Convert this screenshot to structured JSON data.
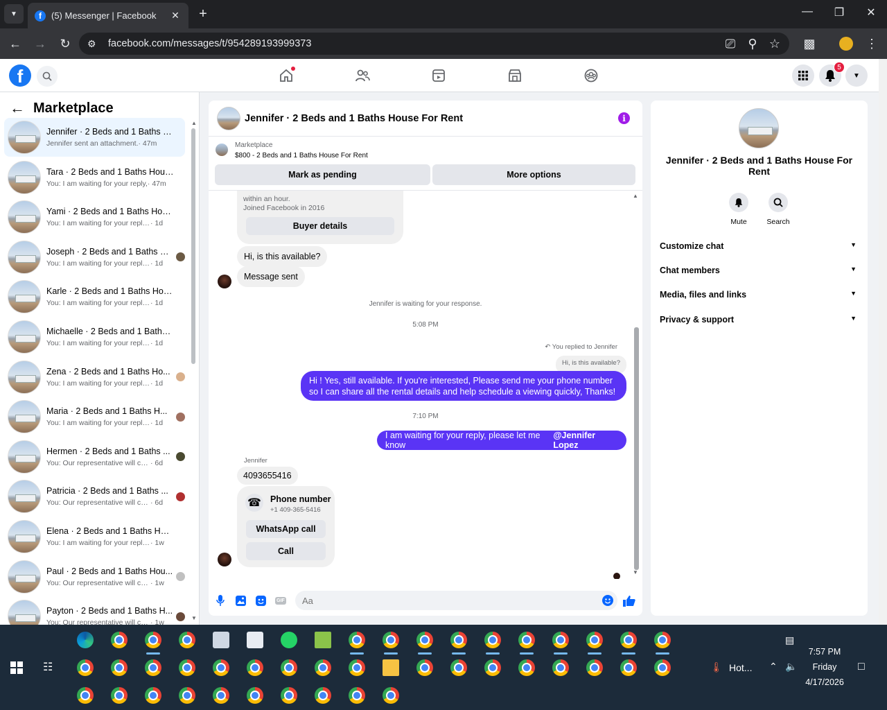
{
  "browser": {
    "tab_title": "(5) Messenger | Facebook",
    "url": "facebook.com/messages/t/954289193999373"
  },
  "fb": {
    "notification_count": "5"
  },
  "sidebar": {
    "title": "Marketplace",
    "conversations": [
      {
        "name": "Jennifer · 2 Beds and 1 Baths Ho...",
        "preview": "Jennifer sent an attachment.",
        "time": "· 47m"
      },
      {
        "name": "Tara · 2 Beds and 1 Baths House...",
        "preview": "You: I am waiting for your reply,",
        "time": "· 47m"
      },
      {
        "name": "Yami · 2 Beds and 1 Baths Hous...",
        "preview": "You: I am waiting for your reply, pl...",
        "time": "· 1d"
      },
      {
        "name": "Joseph · 2 Beds and 1 Baths H...",
        "preview": "You: I am waiting for your reply,...",
        "time": "· 1d"
      },
      {
        "name": "Karle · 2 Beds and 1 Baths Hous...",
        "preview": "You: I am waiting for your reply, pl...",
        "time": "· 1d"
      },
      {
        "name": "Michaelle · 2 Beds and 1 Baths ...",
        "preview": "You: I am waiting for your reply, pl...",
        "time": "· 1d"
      },
      {
        "name": "Zena · 2 Beds and 1 Baths Ho...",
        "preview": "You: I am waiting for your reply,...",
        "time": "· 1d"
      },
      {
        "name": "Maria · 2 Beds and 1 Baths H...",
        "preview": "You: I am waiting for your reply,...",
        "time": "· 1d"
      },
      {
        "name": "Hermen · 2 Beds and 1 Baths ...",
        "preview": "You: Our representative will con...",
        "time": "· 6d"
      },
      {
        "name": "Patricia · 2 Beds and 1 Baths ...",
        "preview": "You: Our representative will con...",
        "time": "· 6d"
      },
      {
        "name": "Elena · 2 Beds and 1 Baths Hous...",
        "preview": "You: I am waiting for your reply, pl...",
        "time": "· 1w"
      },
      {
        "name": "Paul · 2 Beds and 1 Baths Hou...",
        "preview": "You: Our representative will con...",
        "time": "· 1w"
      },
      {
        "name": "Payton · 2 Beds and 1 Baths H...",
        "preview": "You: Our representative will con...",
        "time": "· 1w"
      }
    ]
  },
  "chat": {
    "title": "Jennifer · 2 Beds and 1 Baths House For Rent",
    "marketplace_label": "Marketplace",
    "listing": "$800 - 2 Beds and 1 Baths House For Rent",
    "mark_pending": "Mark as pending",
    "more_options": "More options",
    "buyer_info_partial": "within an hour.",
    "joined": "Joined Facebook in 2016",
    "buyer_details": "Buyer details",
    "msg_available": "Hi, is this available?",
    "msg_sent": "Message sent",
    "waiting_notice": "Jennifer is waiting for your response.",
    "time1": "5:08 PM",
    "replied_to": "You replied to Jennifer",
    "quoted": "Hi, is this available?",
    "reply_msg": "Hi ! Yes, still available. If you're interested, Please send me your phone number so I can share all the rental details and help schedule a viewing quickly, Thanks!",
    "time2": "7:10 PM",
    "waiting_msg": "I am waiting for your reply, please let me know",
    "mention": "@Jennifer Lopez",
    "sender_name": "Jennifer",
    "phone_msg": "4093655416",
    "phone_card_title": "Phone number",
    "phone_card_number": "+1 409-365-5416",
    "whatsapp_call": "WhatsApp call",
    "call": "Call",
    "input_placeholder": "Aa"
  },
  "right_panel": {
    "name": "Jennifer · 2 Beds and 1 Baths House For Rent",
    "mute": "Mute",
    "search": "Search",
    "sections": [
      "Customize chat",
      "Chat members",
      "Media, files and links",
      "Privacy & support"
    ]
  },
  "taskbar": {
    "weather": "Hot...",
    "time": "7:57 PM",
    "day": "Friday",
    "date": "4/17/2026"
  },
  "colors": {
    "fb_blue": "#1877f2",
    "bubble_purple": "#5a34f5",
    "info_purple": "#a01ce8"
  }
}
